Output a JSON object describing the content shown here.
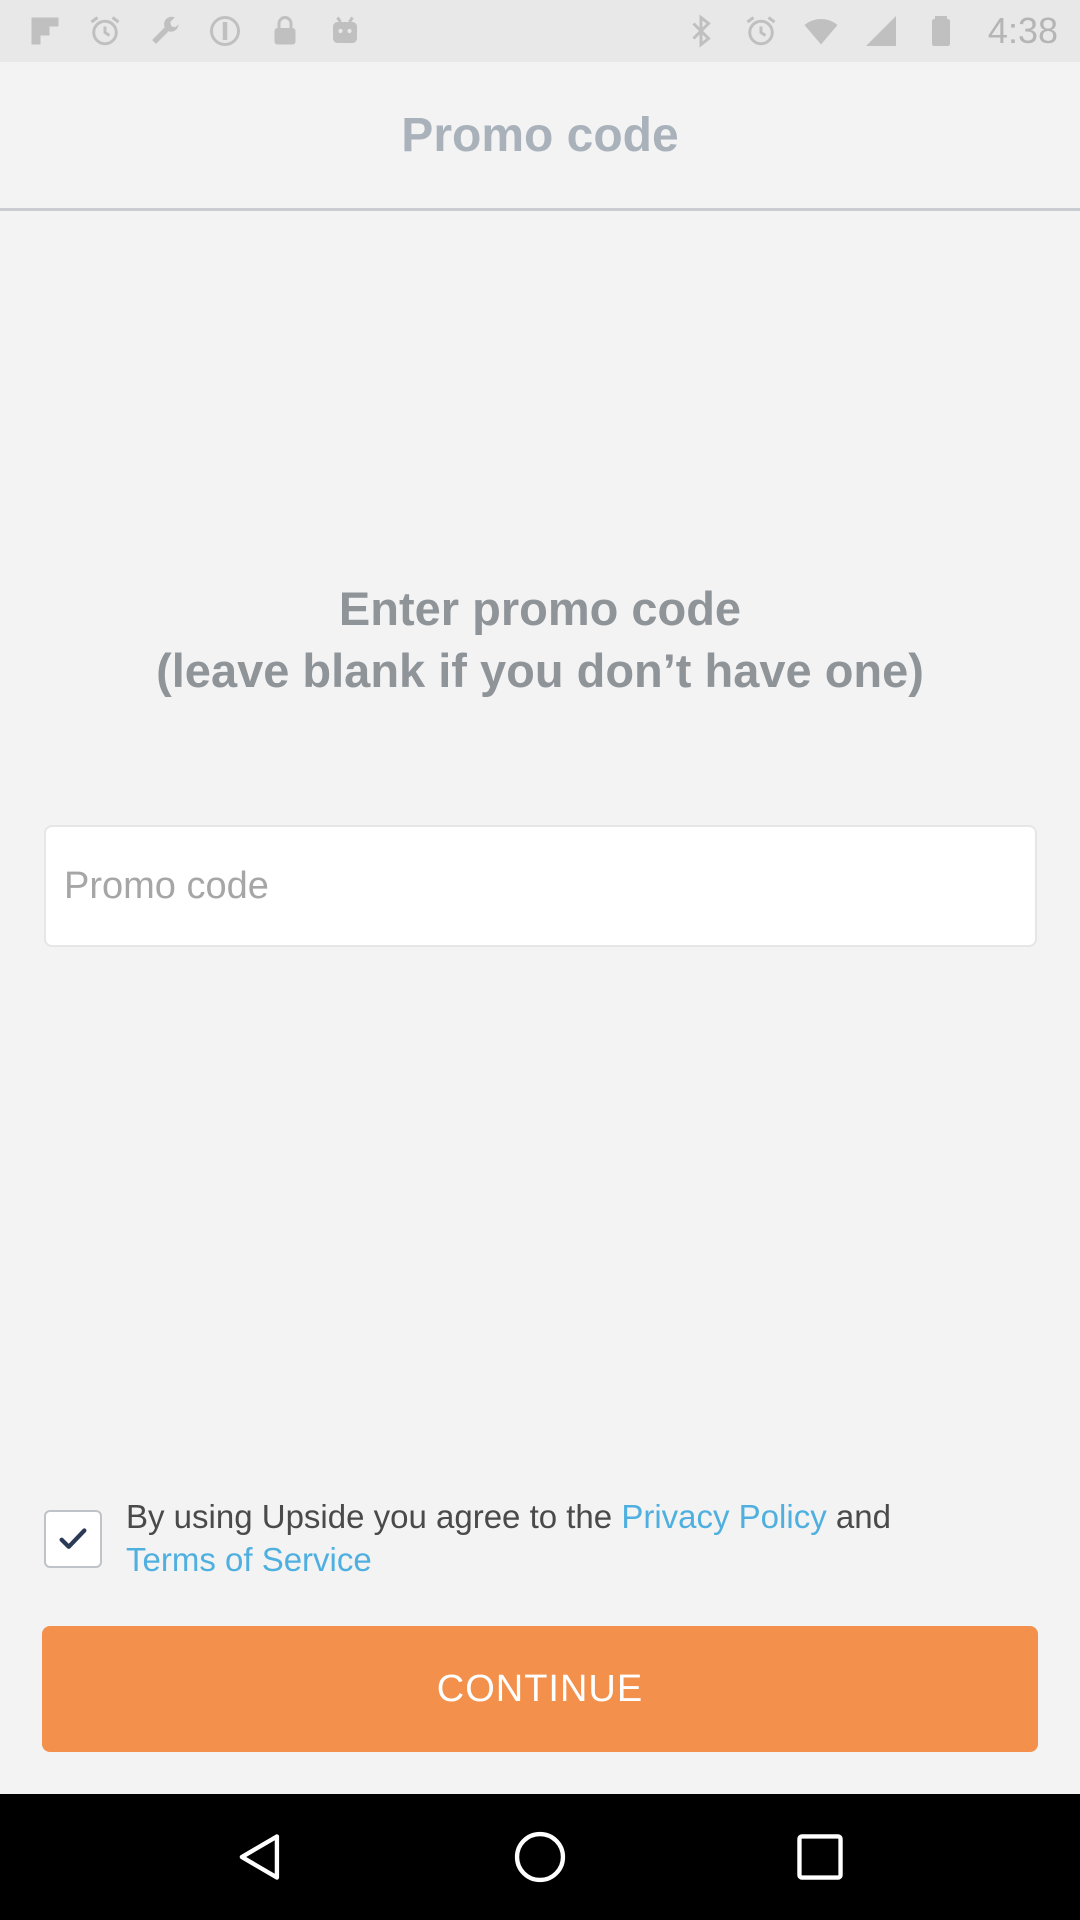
{
  "status_bar": {
    "time": "4:38",
    "left_icons": [
      "flipboard-icon",
      "alarm-icon",
      "wrench-icon",
      "sync-icon",
      "lock-icon",
      "android-icon"
    ],
    "right_icons": [
      "bluetooth-icon",
      "alarm-icon",
      "wifi-icon",
      "signal-icon",
      "battery-icon"
    ]
  },
  "header": {
    "title": "Promo code"
  },
  "prompt": {
    "line1": "Enter promo code",
    "line2": "(leave blank if you don’t have one)"
  },
  "promo_input": {
    "placeholder": "Promo code",
    "value": ""
  },
  "agreement": {
    "checked": true,
    "text_before": "By using Upside you agree to the ",
    "privacy_link": "Privacy Policy",
    "text_middle": " and",
    "terms_link": "Terms of Service"
  },
  "continue_button": {
    "label": "CONTINUE"
  },
  "nav": {
    "buttons": [
      "back-icon",
      "home-icon",
      "recents-icon"
    ]
  },
  "colors": {
    "accent": "#f2904c",
    "link": "#4fb0e0",
    "title": "#a9b2bb",
    "background": "#f3f3f3"
  }
}
